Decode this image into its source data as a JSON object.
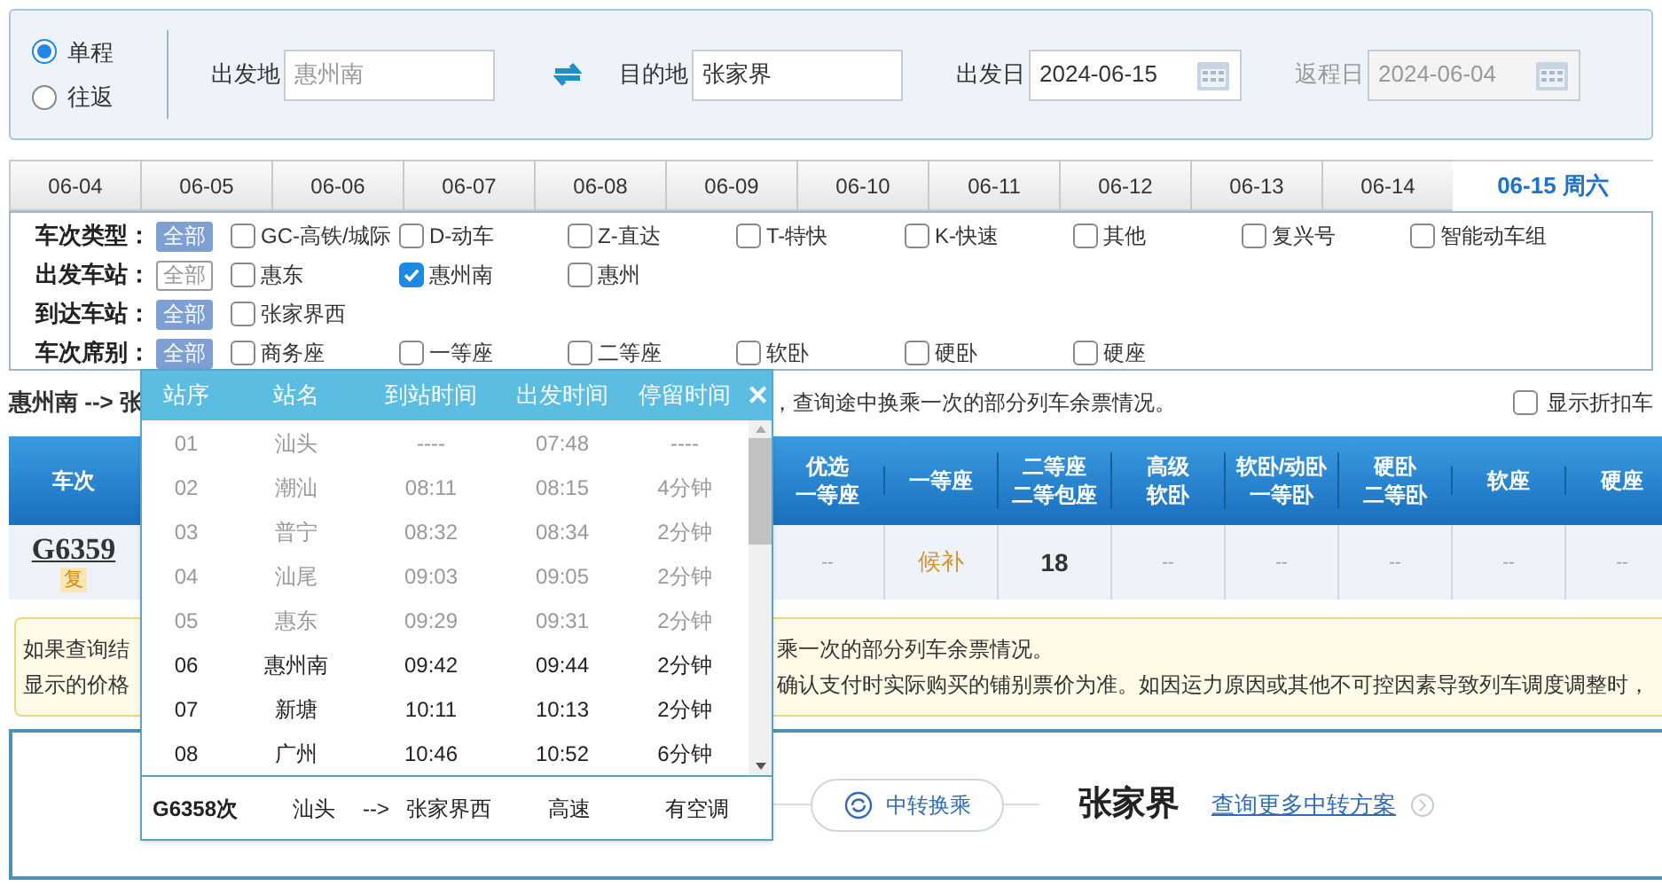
{
  "trip_types": [
    {
      "label": "单程",
      "selected": true
    },
    {
      "label": "往返",
      "selected": false
    }
  ],
  "search": {
    "fields": [
      {
        "label": "出发地",
        "value": "惠州南",
        "kind": "text",
        "disabled": false
      },
      {
        "label": "目的地",
        "value": "张家界",
        "kind": "text",
        "disabled": false
      },
      {
        "label": "出发日",
        "value": "2024-06-15",
        "kind": "date",
        "disabled": false
      },
      {
        "label": "返程日",
        "value": "2024-06-04",
        "kind": "date",
        "disabled": true
      }
    ]
  },
  "date_tabs": [
    {
      "label": "06-04",
      "selected": false
    },
    {
      "label": "06-05",
      "selected": false
    },
    {
      "label": "06-06",
      "selected": false
    },
    {
      "label": "06-07",
      "selected": false
    },
    {
      "label": "06-08",
      "selected": false
    },
    {
      "label": "06-09",
      "selected": false
    },
    {
      "label": "06-10",
      "selected": false
    },
    {
      "label": "06-11",
      "selected": false
    },
    {
      "label": "06-12",
      "selected": false
    },
    {
      "label": "06-13",
      "selected": false
    },
    {
      "label": "06-14",
      "selected": false
    },
    {
      "label": "06-15 周六",
      "selected": true
    }
  ],
  "filters": [
    {
      "label": "车次类型：",
      "all": "全部",
      "all_selected": true,
      "options": [
        {
          "label": "GC-高铁/城际",
          "checked": false
        },
        {
          "label": "D-动车",
          "checked": false
        },
        {
          "label": "Z-直达",
          "checked": false
        },
        {
          "label": "T-特快",
          "checked": false
        },
        {
          "label": "K-快速",
          "checked": false
        },
        {
          "label": "其他",
          "checked": false
        },
        {
          "label": "复兴号",
          "checked": false
        },
        {
          "label": "智能动车组",
          "checked": false
        }
      ]
    },
    {
      "label": "出发车站：",
      "all": "全部",
      "all_selected": false,
      "options": [
        {
          "label": "惠东",
          "checked": false
        },
        {
          "label": "惠州南",
          "checked": true
        },
        {
          "label": "惠州",
          "checked": false
        }
      ]
    },
    {
      "label": "到达车站：",
      "all": "全部",
      "all_selected": true,
      "options": [
        {
          "label": "张家界西",
          "checked": false
        }
      ]
    },
    {
      "label": "车次席别：",
      "all": "全部",
      "all_selected": true,
      "options": [
        {
          "label": "商务座",
          "checked": false
        },
        {
          "label": "一等座",
          "checked": false
        },
        {
          "label": "二等座",
          "checked": false
        },
        {
          "label": "软卧",
          "checked": false
        },
        {
          "label": "硬卧",
          "checked": false
        },
        {
          "label": "硬座",
          "checked": false
        }
      ]
    }
  ],
  "info_line": {
    "left": "惠州南 --> 张",
    "right": "，查询途中换乘一次的部分列车余票情况。",
    "discount_checkbox": {
      "label": "显示折扣车",
      "checked": false
    }
  },
  "table": {
    "columns": [
      {
        "lines": [
          "车次"
        ]
      },
      {
        "lines": [
          "优选",
          "一等座"
        ]
      },
      {
        "lines": [
          "一等座"
        ]
      },
      {
        "lines": [
          "二等座",
          "二等包座"
        ]
      },
      {
        "lines": [
          "高级",
          "软卧"
        ]
      },
      {
        "lines": [
          "软卧/动卧",
          "一等卧"
        ]
      },
      {
        "lines": [
          "硬卧",
          "二等卧"
        ]
      },
      {
        "lines": [
          "软座"
        ]
      },
      {
        "lines": [
          "硬座"
        ]
      }
    ],
    "rows": [
      {
        "cells": [
          {
            "text": "G6359",
            "badge": "复",
            "kind": "train"
          },
          {
            "text": "--",
            "kind": "none"
          },
          {
            "text": "候补",
            "kind": "waitlist"
          },
          {
            "text": "18",
            "kind": "count"
          },
          {
            "text": "--",
            "kind": "none"
          },
          {
            "text": "--",
            "kind": "none"
          },
          {
            "text": "--",
            "kind": "none"
          },
          {
            "text": "--",
            "kind": "none"
          },
          {
            "text": "--",
            "kind": "none"
          }
        ]
      }
    ]
  },
  "notice": [
    {
      "left": "如果查询结",
      "right": "乘一次的部分列车余票情况。"
    },
    {
      "left": "显示的价格",
      "right": "确认支付时实际购买的铺别票价为准。如因运力原因或其他不可控因素导致列车调度调整时，"
    }
  ],
  "transfer": {
    "button": "中转换乘",
    "city": "张家界",
    "link": "查询更多中转方案"
  },
  "stops_popup": {
    "columns": [
      "站序",
      "站名",
      "到站时间",
      "出发时间",
      "停留时间"
    ],
    "close": "✕",
    "stops": [
      {
        "no": "01",
        "station": "汕头",
        "arrive": "----",
        "depart": "07:48",
        "stay": "----",
        "before_boarding": true
      },
      {
        "no": "02",
        "station": "潮汕",
        "arrive": "08:11",
        "depart": "08:15",
        "stay": "4分钟",
        "before_boarding": true
      },
      {
        "no": "03",
        "station": "普宁",
        "arrive": "08:32",
        "depart": "08:34",
        "stay": "2分钟",
        "before_boarding": true
      },
      {
        "no": "04",
        "station": "汕尾",
        "arrive": "09:03",
        "depart": "09:05",
        "stay": "2分钟",
        "before_boarding": true
      },
      {
        "no": "05",
        "station": "惠东",
        "arrive": "09:29",
        "depart": "09:31",
        "stay": "2分钟",
        "before_boarding": true
      },
      {
        "no": "06",
        "station": "惠州南",
        "arrive": "09:42",
        "depart": "09:44",
        "stay": "2分钟",
        "before_boarding": false
      },
      {
        "no": "07",
        "station": "新塘",
        "arrive": "10:11",
        "depart": "10:13",
        "stay": "2分钟",
        "before_boarding": false
      },
      {
        "no": "08",
        "station": "广州",
        "arrive": "10:46",
        "depart": "10:52",
        "stay": "6分钟",
        "before_boarding": false
      }
    ],
    "footer": {
      "train": "G6358次",
      "from": "汕头",
      "arrow": "-->",
      "to": "张家界西",
      "type": "高速",
      "aircon": "有空调"
    }
  }
}
